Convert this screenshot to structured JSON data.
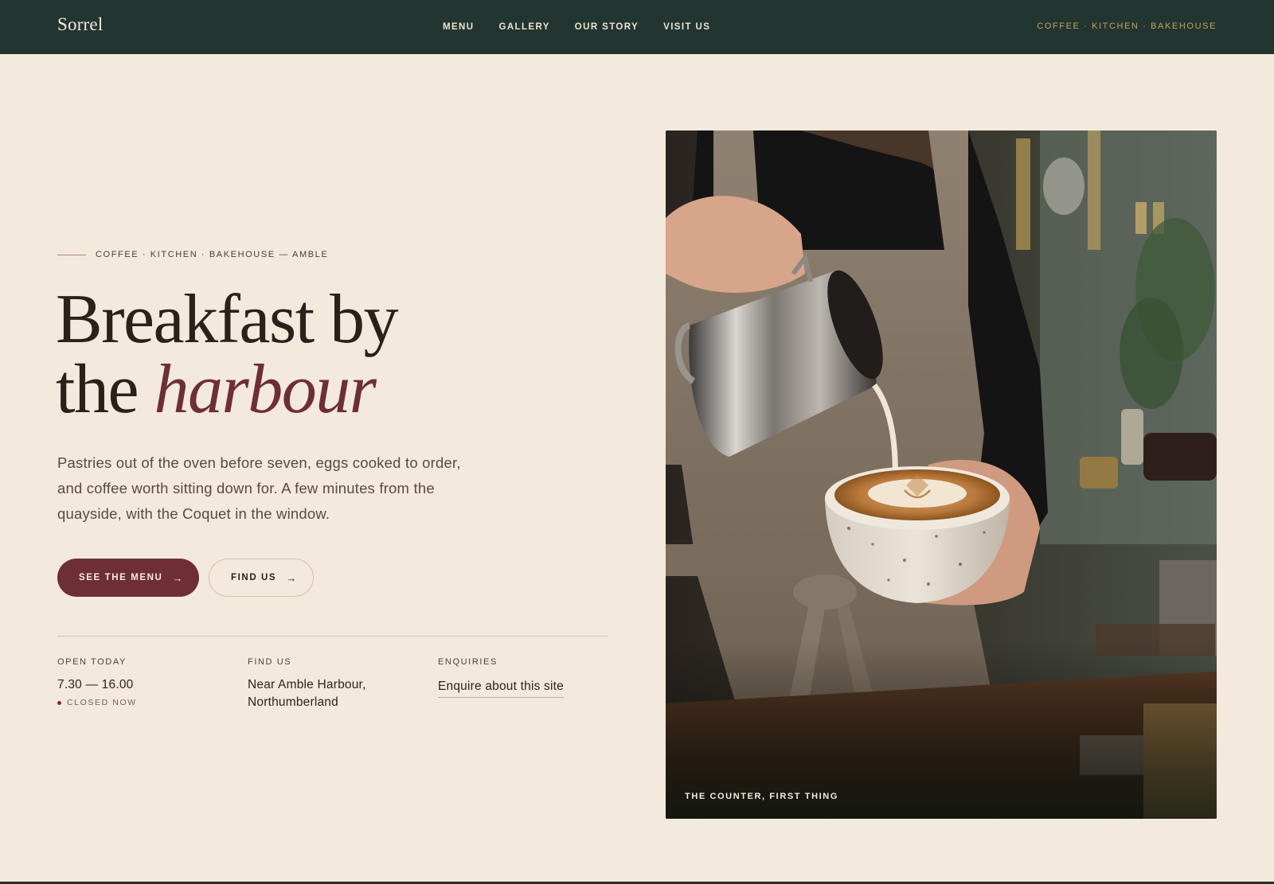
{
  "header": {
    "brand": "Sorrel",
    "nav": [
      {
        "label": "MENU"
      },
      {
        "label": "GALLERY"
      },
      {
        "label": "OUR STORY"
      },
      {
        "label": "VISIT US"
      }
    ],
    "tagline": "COFFEE · KITCHEN · BAKEHOUSE"
  },
  "hero": {
    "kicker": "COFFEE · KITCHEN · BAKEHOUSE — AMBLE",
    "headline_line1": "Breakfast by",
    "headline_line2_plain": "the ",
    "headline_line2_accent": "harbour",
    "lede": "Pastries out of the oven before seven, eggs cooked to order, and coffee worth sitting down for. A few minutes from the quayside, with the Coquet in the window.",
    "primary_button": "SEE THE MENU",
    "secondary_button": "FIND US",
    "arrow": "→"
  },
  "info": {
    "hours_label": "OPEN TODAY",
    "hours_value": "7.30 — 16.00",
    "status": "CLOSED NOW",
    "location_label": "FIND US",
    "location_line1": "Near Amble Harbour,",
    "location_line2": "Northumberland",
    "enquiries_label": "ENQUIRIES",
    "enquiries_link": "Enquire about this site"
  },
  "photo": {
    "caption": "THE COUNTER, FIRST THING",
    "subject": "barista-pouring-latte-art"
  },
  "colors": {
    "header_bg": "#233530",
    "page_bg": "#f3e9dc",
    "accent": "#6e2e36",
    "gold": "#c79f5e"
  }
}
